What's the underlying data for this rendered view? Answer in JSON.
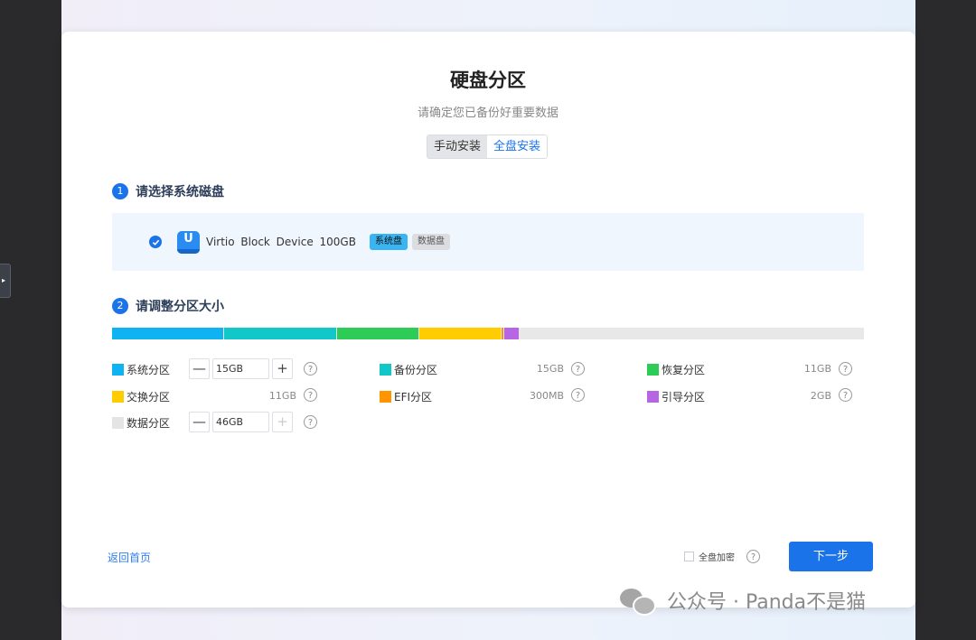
{
  "dialog": {
    "title": "硬盘分区",
    "subtitle": "请确定您已备份好重要数据",
    "mode_tabs": [
      {
        "label": "手动安装",
        "active": false
      },
      {
        "label": "全盘安装",
        "active": true
      }
    ]
  },
  "step1": {
    "number": "1",
    "title": "请选择系统磁盘",
    "disk": {
      "name": "Virtio Block Device 100GB",
      "selected": true,
      "tags": [
        "系统盘",
        "数据盘"
      ]
    }
  },
  "step2": {
    "number": "2",
    "title": "请调整分区大小",
    "partitions": [
      {
        "label": "系统分区",
        "size": "15GB",
        "size_gb": 15,
        "color": "#0fb3f2",
        "editable": true
      },
      {
        "label": "备份分区",
        "size": "15GB",
        "size_gb": 15,
        "color": "#12c7c7",
        "editable": false
      },
      {
        "label": "恢复分区",
        "size": "11GB",
        "size_gb": 11,
        "color": "#2ccc57",
        "editable": false
      },
      {
        "label": "交换分区",
        "size": "11GB",
        "size_gb": 11,
        "color": "#ffcc00",
        "editable": false
      },
      {
        "label": "EFI分区",
        "size": "300MB",
        "size_gb": 0.3,
        "color": "#ff9500",
        "editable": false
      },
      {
        "label": "引导分区",
        "size": "2GB",
        "size_gb": 2,
        "color": "#b766e3",
        "editable": false
      },
      {
        "label": "数据分区",
        "size": "46GB",
        "size_gb": 46,
        "color": "#e4e4e4",
        "editable": true
      }
    ],
    "help_glyph": "?",
    "minus_glyph": "—",
    "plus_glyph": "+"
  },
  "footer": {
    "back_label": "返回首页",
    "encrypt_label": "全盘加密",
    "encrypt_checked": false,
    "next_label": "下一步"
  },
  "watermark": "公众号 · Panda不是猫",
  "sidebar_handle_glyph": "▸"
}
